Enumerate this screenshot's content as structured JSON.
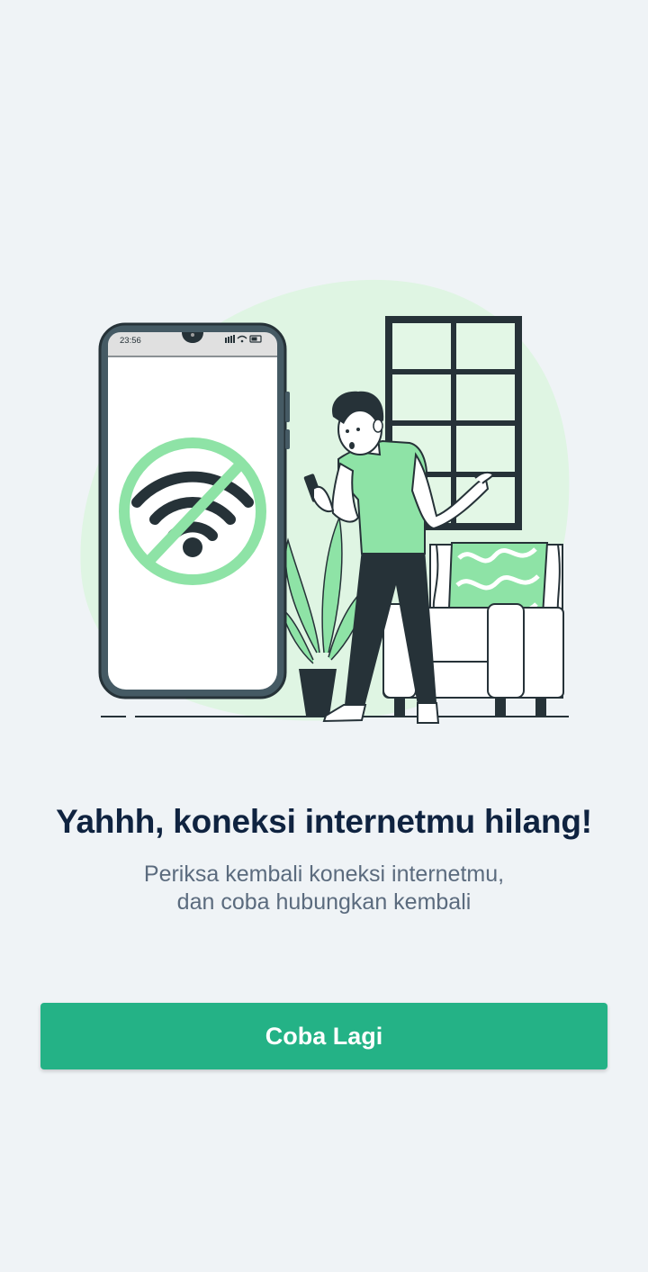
{
  "illustration": {
    "phone_time": "23:56",
    "accent_color": "#8ee3a6",
    "dark_color": "#263238"
  },
  "message": {
    "title": "Yahhh, koneksi internetmu hilang!",
    "subtitle_line1": "Periksa kembali koneksi internetmu,",
    "subtitle_line2": "dan coba hubungkan kembali"
  },
  "actions": {
    "retry_label": "Coba Lagi",
    "retry_color": "#24b286"
  }
}
